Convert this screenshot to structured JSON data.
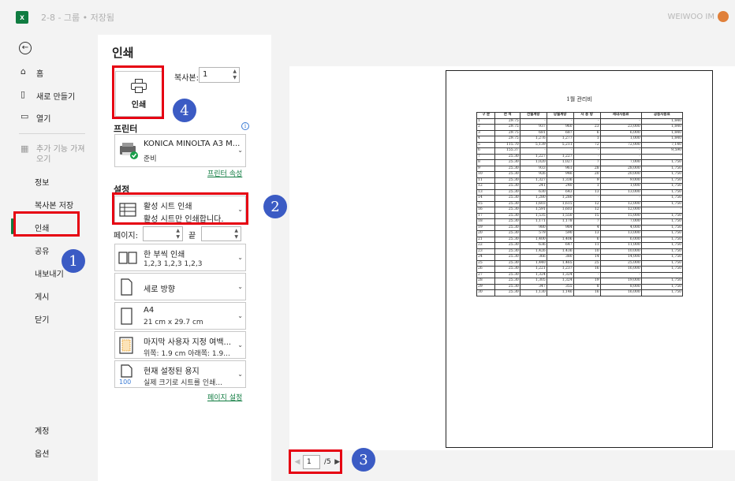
{
  "titlebar": {
    "app_icon_letter": "x",
    "file_name": "2-8 - 그룹 • 저장됨",
    "user_name": "WEIWOO IM"
  },
  "sidebar": {
    "back": "←",
    "items": [
      {
        "icon": "⌂",
        "label": "홈"
      },
      {
        "icon": "▯",
        "label": "새로 만들기"
      },
      {
        "icon": "▭",
        "label": "열기"
      },
      {
        "icon": "▦",
        "label": "추가 기능 가져오기"
      }
    ],
    "menu": [
      "정보",
      "복사본 저장",
      "인쇄",
      "공유",
      "내보내기",
      "게시",
      "닫기"
    ],
    "bottom": [
      "계정",
      "옵션"
    ]
  },
  "panel": {
    "title": "인쇄",
    "print_button": "인쇄",
    "copies_label": "복사본:",
    "copies_value": "1",
    "printer_section": "프린터",
    "printer_name": "KONICA MINOLTA A3 M...",
    "printer_status": "준비",
    "printer_props_link": "프린터 속성",
    "settings_section": "설정",
    "active_sheet_title": "활성 시트 인쇄",
    "active_sheet_desc": "활성 시트만 인쇄합니다.",
    "pages_label": "페이지:",
    "end_label": "끝",
    "collate_title": "한 부씩 인쇄",
    "collate_desc": "1,2,3    1,2,3    1,2,3",
    "orientation": "세로 방향",
    "paper_title": "A4",
    "paper_desc": "21 cm x 29.7 cm",
    "margins_title": "마지막 사용자 지정 여백...",
    "margins_desc": "위쪽: 1.9 cm 아래쪽: 1.9...",
    "scaling_title": "현재 설정된 용지",
    "scaling_desc": "실제 크기로 시트를 인쇄...",
    "scaling_icon_text": "100",
    "page_setup_link": "페이지 설정"
  },
  "preview": {
    "sheet_title": "1월 관리비",
    "headers": [
      "구 분",
      "면 적",
      "전월계량",
      "당월계량",
      "사 용 량",
      "세대사용료",
      "공동사용료"
    ],
    "rows": [
      [
        "1",
        "29.75",
        "-",
        "-",
        "-",
        "-",
        "1,840"
      ],
      [
        "2",
        "29.75",
        "937",
        "960",
        "23",
        "23,000",
        "1,840"
      ],
      [
        "3",
        "29.75",
        "681",
        "687",
        "6",
        "6,000",
        "1,840"
      ],
      [
        "4",
        "29.75",
        "1,276",
        "1,277",
        "1",
        "1,000",
        "1,840"
      ],
      [
        "5",
        "115.70",
        "5,139",
        "5,211",
        "72",
        "72,000",
        "7,140"
      ],
      [
        "6",
        "155.37",
        "-",
        "-",
        "-",
        "-",
        "9,590"
      ],
      [
        "7",
        "25.30",
        "1,227",
        "1,227",
        "-",
        "-",
        "-"
      ],
      [
        "8",
        "25.30",
        "1,020",
        "1,027",
        "7",
        "7,000",
        "1,750"
      ],
      [
        "9",
        "25.30",
        "933",
        "961",
        "28",
        "28,000",
        "1,750"
      ],
      [
        "10",
        "25.30",
        "926",
        "946",
        "20",
        "20,000",
        "1,750"
      ],
      [
        "11",
        "25.30",
        "1,327",
        "1,336",
        "9",
        "9,000",
        "1,750"
      ],
      [
        "12",
        "25.30",
        "241",
        "240",
        "1",
        "1,000",
        "1,750"
      ],
      [
        "13",
        "25.30",
        "630",
        "643",
        "13",
        "13,000",
        "1,750"
      ],
      [
        "14",
        "25.30",
        "1,280",
        "1,280",
        "-",
        "-",
        "1,750"
      ],
      [
        "15",
        "25.30",
        "1,603",
        "1,615",
        "12",
        "12,000",
        "1,750"
      ],
      [
        "16",
        "25.30",
        "1,591",
        "1,603",
        "12",
        "12,000",
        "-"
      ],
      [
        "17",
        "25.30",
        "1,535",
        "1,550",
        "15",
        "15,000",
        "1,750"
      ],
      [
        "18",
        "25.30",
        "1,171",
        "1,178",
        "7",
        "7,000",
        "1,750"
      ],
      [
        "19",
        "25.30",
        "980",
        "984",
        "4",
        "4,000",
        "1,750"
      ],
      [
        "20",
        "25.30",
        "579",
        "590",
        "13",
        "13,000",
        "1,750"
      ],
      [
        "21",
        "25.30",
        "1,400",
        "1,406",
        "6",
        "6,000",
        "1,750"
      ],
      [
        "22",
        "25.30",
        "636",
        "647",
        "11",
        "11,000",
        "1,750"
      ],
      [
        "23",
        "25.30",
        "1,426",
        "1,436",
        "10",
        "10,000",
        "1,750"
      ],
      [
        "24",
        "25.30",
        "366",
        "380",
        "14",
        "14,000",
        "1,750"
      ],
      [
        "25",
        "25.30",
        "1,440",
        "1,465",
        "25",
        "25,000",
        "1,750"
      ],
      [
        "26",
        "25.30",
        "1,221",
        "1,237",
        "16",
        "16,000",
        "1,750"
      ],
      [
        "27",
        "25.30",
        "1,324",
        "1,324",
        "-",
        "-",
        "-"
      ],
      [
        "28",
        "25.30",
        "1,305",
        "1,324",
        "19",
        "19,000",
        "1,750"
      ],
      [
        "29",
        "25.30",
        "347",
        "355",
        "8",
        "8,000",
        "1,750"
      ],
      [
        "30",
        "25.30",
        "1,130",
        "1,146",
        "16",
        "16,000",
        "1,750"
      ]
    ],
    "nav": {
      "prev": "◀",
      "page": "1",
      "total": "/5",
      "next": "▶"
    }
  },
  "badges": [
    "1",
    "2",
    "3",
    "4"
  ],
  "colors": {
    "highlight": "#e60012",
    "badge": "#3b5bc4",
    "accent": "#107c41"
  }
}
